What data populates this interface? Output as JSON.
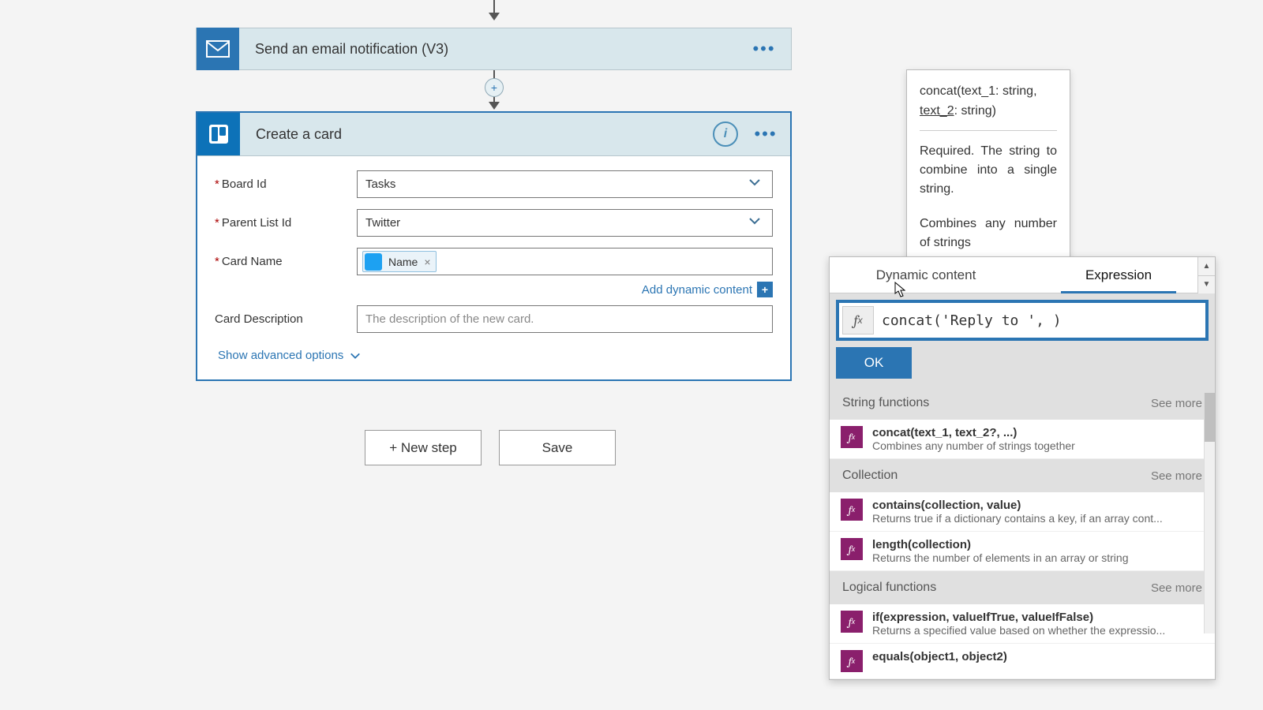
{
  "flow": {
    "email_step_title": "Send an email notification (V3)",
    "create_card_title": "Create a card",
    "fields": {
      "board_id": {
        "label": "Board Id",
        "value": "Tasks"
      },
      "parent_list_id": {
        "label": "Parent List Id",
        "value": "Twitter"
      },
      "card_name": {
        "label": "Card Name",
        "token": "Name"
      },
      "card_desc": {
        "label": "Card Description",
        "placeholder": "The description of the new card."
      }
    },
    "add_dynamic_content": "Add dynamic content",
    "show_advanced": "Show advanced options",
    "new_step": "+ New step",
    "save": "Save"
  },
  "tooltip": {
    "sig_prefix": "concat(text_1: string, ",
    "sig_underlined": "text_2",
    "sig_suffix": ": string)",
    "desc1": "Required. The string to combine into a single string.",
    "desc2": "Combines any number of strings"
  },
  "expr_popup": {
    "tab_dynamic": "Dynamic content",
    "tab_expression": "Expression",
    "expr_value": "concat('Reply to ', )",
    "ok": "OK",
    "see_more": "See more",
    "categories": [
      {
        "name": "String functions",
        "items": [
          {
            "sig": "concat(text_1, text_2?, ...)",
            "desc": "Combines any number of strings together"
          }
        ]
      },
      {
        "name": "Collection",
        "items": [
          {
            "sig": "contains(collection, value)",
            "desc": "Returns true if a dictionary contains a key, if an array cont..."
          },
          {
            "sig": "length(collection)",
            "desc": "Returns the number of elements in an array or string"
          }
        ]
      },
      {
        "name": "Logical functions",
        "items": [
          {
            "sig": "if(expression, valueIfTrue, valueIfFalse)",
            "desc": "Returns a specified value based on whether the expressio..."
          },
          {
            "sig": "equals(object1, object2)",
            "desc": ""
          }
        ]
      }
    ]
  }
}
